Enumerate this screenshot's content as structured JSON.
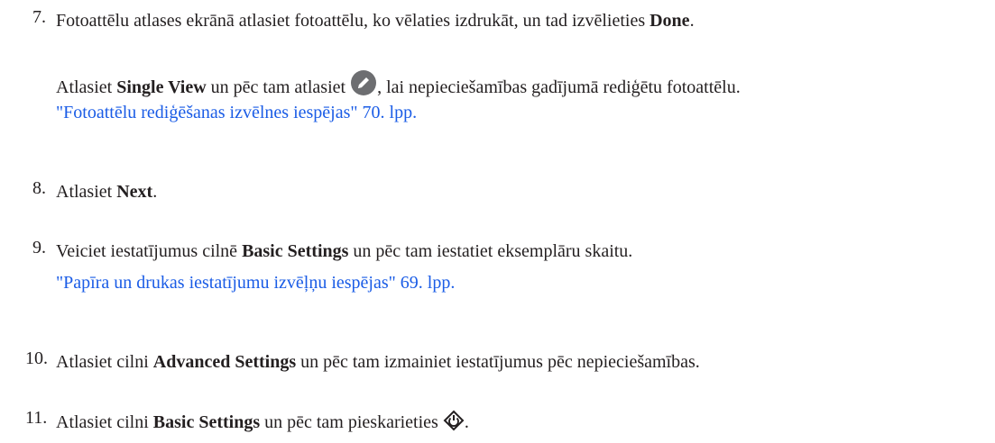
{
  "steps": [
    {
      "num": "7.",
      "pre": "Fotoattēlu atlases ekrānā atlasiet fotoattēlu, ko vēlaties izdrukāt, un tad izvēlieties ",
      "bold": "Done",
      "post": "."
    },
    {
      "sub_pre": "Atlasiet ",
      "sub_bold": "Single View",
      "sub_mid": " un pēc tam atlasiet ",
      "sub_icon": "edit-pencil-icon",
      "sub_post": ", lai nepieciešamības gadījumā rediģētu fotoattēlu.",
      "link": "\"Fotoattēlu rediģēšanas izvēlnes iespējas\" 70. lpp."
    },
    {
      "num": "8.",
      "pre": "Atlasiet ",
      "bold": "Next",
      "post": "."
    },
    {
      "num": "9.",
      "pre": "Veiciet iestatījumus cilnē ",
      "bold": "Basic Settings",
      "post": " un pēc tam iestatiet eksemplāru skaitu.",
      "link": "\"Papīra un drukas iestatījumu izvēļņu iespējas\" 69. lpp."
    },
    {
      "num": "10.",
      "pre": "Atlasiet cilni ",
      "bold": "Advanced Settings",
      "post": " un pēc tam izmainiet iestatījumus pēc nepieciešamības."
    },
    {
      "num": "11.",
      "pre": "Atlasiet cilni ",
      "bold": "Basic Settings",
      "mid": " un pēc tam pieskarieties ",
      "icon": "start-diamond-icon",
      "post": "."
    }
  ],
  "colors": {
    "text": "#231f20",
    "link": "#1a5ce6",
    "icon_fill": "#6d6e71"
  }
}
